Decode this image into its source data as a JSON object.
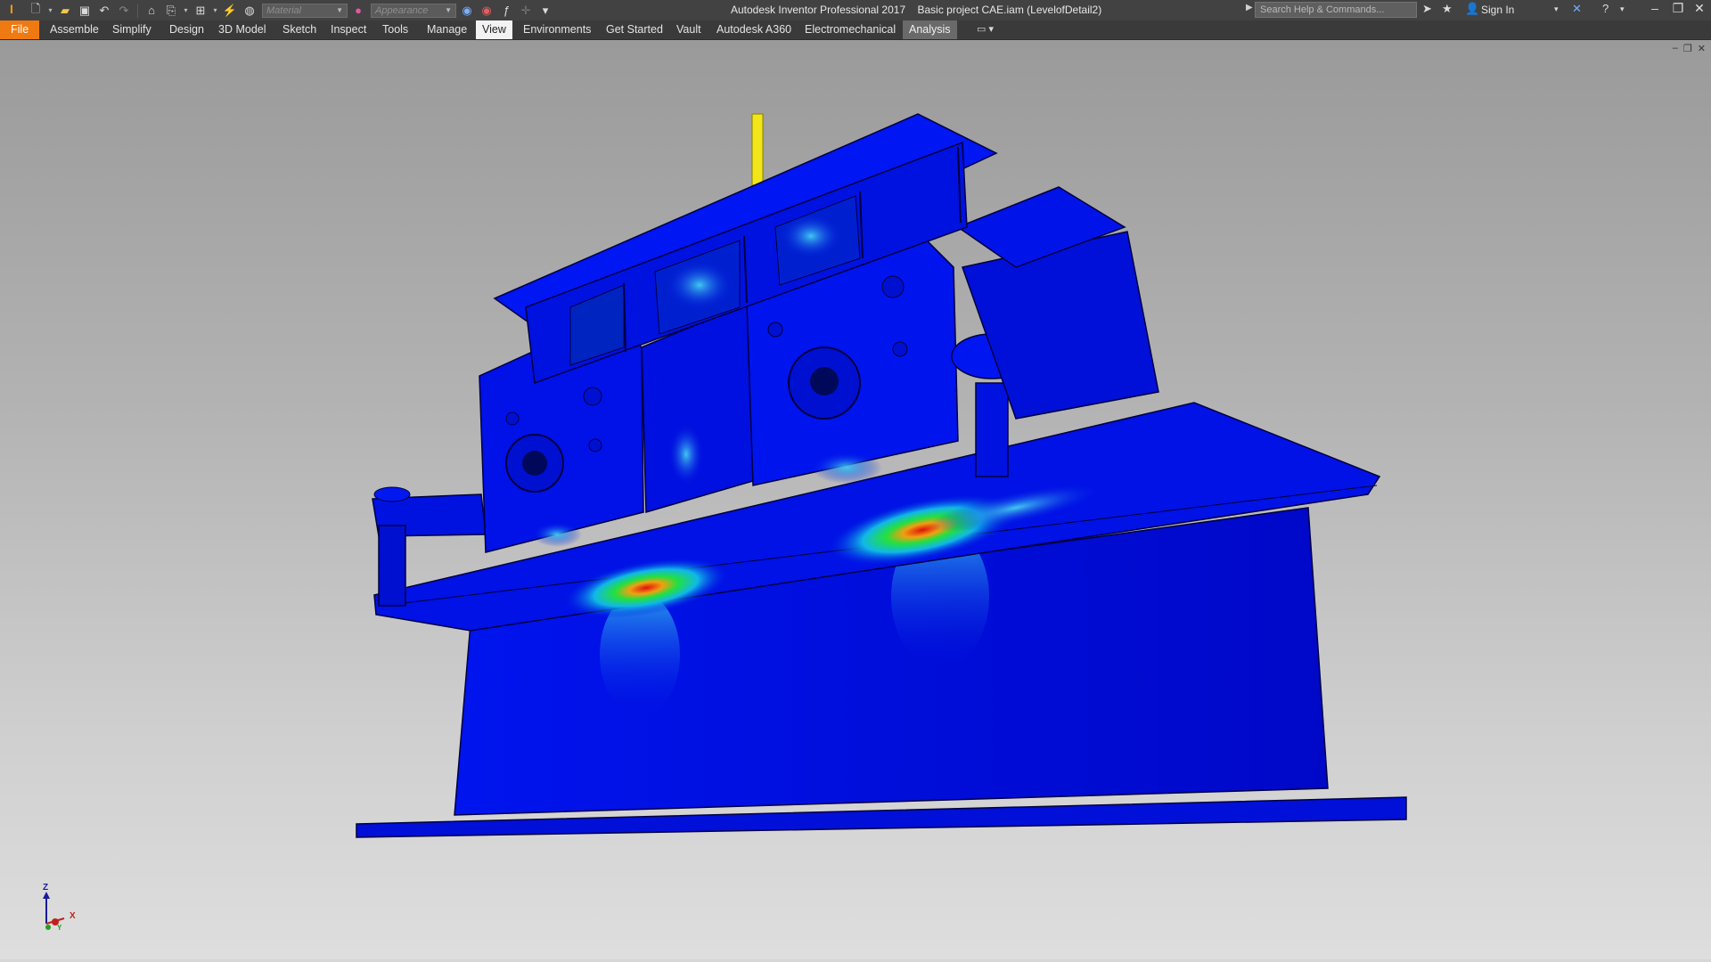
{
  "app": {
    "logo_text": "I",
    "title": "Autodesk Inventor Professional 2017",
    "document": "Basic project CAE.iam (LevelofDetail2)"
  },
  "qat": {
    "material_placeholder": "Material",
    "appearance_placeholder": "Appearance"
  },
  "search": {
    "placeholder": "Search Help & Commands..."
  },
  "account": {
    "sign_in": "Sign In"
  },
  "ribbon": {
    "tabs": [
      {
        "label": "File"
      },
      {
        "label": "Assemble"
      },
      {
        "label": "Simplify"
      },
      {
        "label": "Design"
      },
      {
        "label": "3D Model"
      },
      {
        "label": "Sketch"
      },
      {
        "label": "Inspect"
      },
      {
        "label": "Tools"
      },
      {
        "label": "Manage"
      },
      {
        "label": "View"
      },
      {
        "label": "Environments"
      },
      {
        "label": "Get Started"
      },
      {
        "label": "Vault"
      },
      {
        "label": "Autodesk A360"
      },
      {
        "label": "Electromechanical"
      },
      {
        "label": "Analysis"
      }
    ],
    "active_tab": "View"
  },
  "view_triad": {
    "z": "Z",
    "x": "X",
    "y": "Y"
  },
  "colors": {
    "file_tab": "#f07a12",
    "stress_low": "#0010e0",
    "stress_mid": "#22e040",
    "stress_high": "#e01010",
    "load_arrow": "#f2e61a"
  },
  "icons": [
    "new-icon",
    "open-icon",
    "save-icon",
    "undo-icon",
    "redo-icon",
    "home-icon",
    "return-icon",
    "select-icon",
    "update-icon",
    "appearance-icon",
    "clear-override-icon",
    "parameters-icon",
    "search-arrow-icon",
    "communication-icon",
    "favorites-icon",
    "user-icon",
    "a360-icon",
    "help-icon"
  ]
}
